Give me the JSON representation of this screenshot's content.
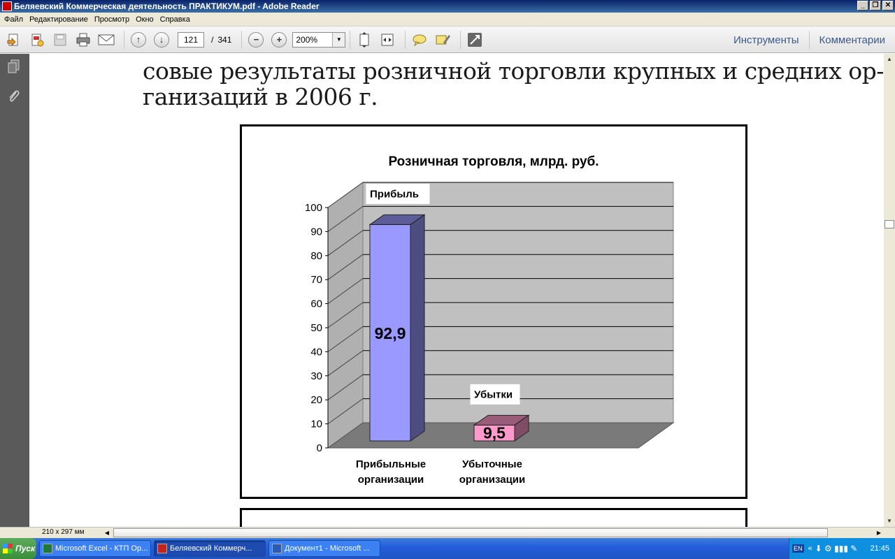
{
  "window": {
    "title": "Беляевский Коммерческая деятельность ПРАКТИКУМ.pdf - Adobe Reader"
  },
  "menu": [
    "Файл",
    "Редактирование",
    "Просмотр",
    "Окно",
    "Справка"
  ],
  "toolbar": {
    "page_current": "121",
    "page_separator": "/",
    "page_total": "341",
    "zoom": "200%",
    "tools_label": "Инструменты",
    "comments_label": "Комментарии"
  },
  "document": {
    "lines": [
      "совые результаты розничной торговли крупных и средних ор-",
      "ганизаций в 2006 г."
    ]
  },
  "chart_data": {
    "type": "bar",
    "title": "Розничная торговля, млрд. руб.",
    "categories": [
      "Прибыльные организации",
      "Убыточные организации"
    ],
    "category_lines": [
      [
        "Прибыльные",
        "организации"
      ],
      [
        "Убыточные",
        "организации"
      ]
    ],
    "series": [
      {
        "name": "Прибыль",
        "values": [
          92.9,
          null
        ],
        "color": "#9999ff"
      },
      {
        "name": "Убытки",
        "values": [
          null,
          9.5
        ],
        "color": "#ff99cc"
      }
    ],
    "data_labels": [
      "92,9",
      "9,5"
    ],
    "ylim": [
      0,
      100
    ],
    "yticks": [
      0,
      10,
      20,
      30,
      40,
      50,
      60,
      70,
      80,
      90,
      100
    ],
    "grid": true,
    "style": "3d"
  },
  "status": {
    "page_size": "210 x 297 мм"
  },
  "taskbar": {
    "start": "Пуск",
    "tasks": [
      {
        "label": "Microsoft Excel - КТП Ор...",
        "active": false
      },
      {
        "label": "Беляевский Коммерч...",
        "active": true
      },
      {
        "label": "Документ1 - Microsoft ...",
        "active": false
      }
    ],
    "lang": "EN",
    "clock": "21:45"
  }
}
